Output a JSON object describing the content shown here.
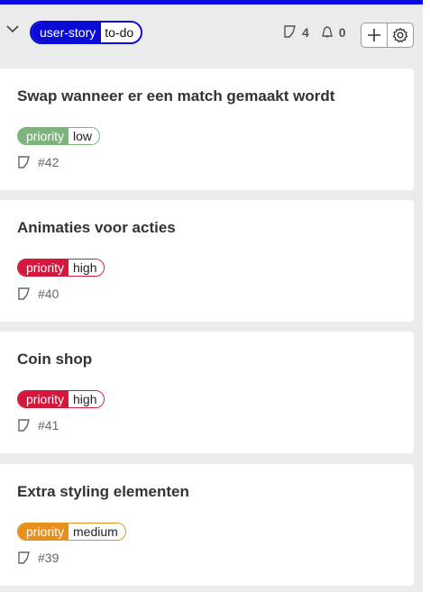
{
  "column": {
    "accent_color": "#0a0ae0",
    "label_key": "user-story",
    "label_value": "to-do",
    "story_count": "4",
    "bug_count": "0",
    "icons": {
      "collapse": "chevron-down-icon",
      "story": "story-icon",
      "bug": "bell-icon",
      "add": "plus-icon",
      "settings": "gear-icon"
    }
  },
  "cards": [
    {
      "title": "Swap wanneer er een match gemaakt wordt",
      "priority_key": "priority",
      "priority_value": "low",
      "priority_color": "#7db37d",
      "issue": "#42"
    },
    {
      "title": "Animaties voor acties",
      "priority_key": "priority",
      "priority_value": "high",
      "priority_color": "#d6173d",
      "issue": "#40"
    },
    {
      "title": "Coin shop",
      "priority_key": "priority",
      "priority_value": "high",
      "priority_color": "#d6173d",
      "issue": "#41"
    },
    {
      "title": "Extra styling elementen",
      "priority_key": "priority",
      "priority_value": "medium",
      "priority_color": "#e8901b",
      "issue": "#39"
    }
  ]
}
